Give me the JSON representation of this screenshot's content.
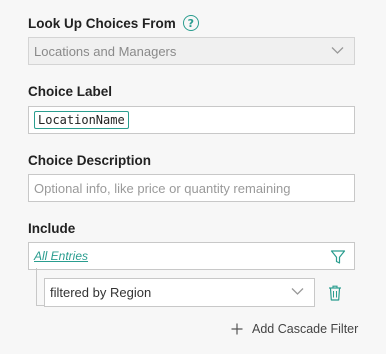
{
  "lookup": {
    "label": "Look Up Choices From",
    "selected": "Locations and Managers"
  },
  "choice_label": {
    "label": "Choice Label",
    "token": "LocationName"
  },
  "choice_description": {
    "label": "Choice Description",
    "placeholder": "Optional info, like price or quantity remaining"
  },
  "include": {
    "label": "Include",
    "entries_link": "All Entries",
    "filter_value": "filtered by Region",
    "add_cascade_label": "Add Cascade Filter"
  },
  "colors": {
    "accent": "#2a9d8f",
    "background": "#f7f7f7",
    "border": "#c8c8c8"
  }
}
